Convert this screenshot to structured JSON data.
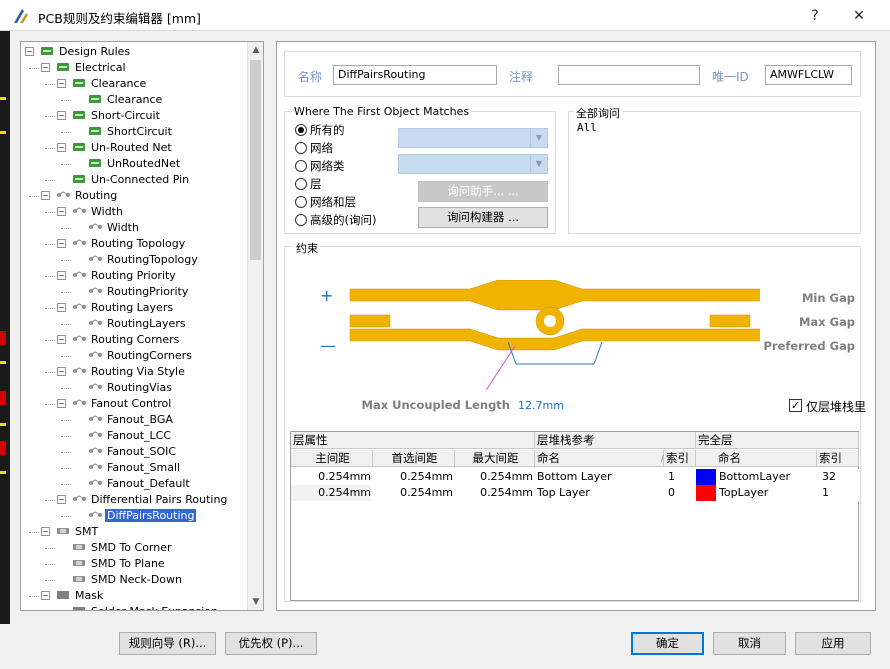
{
  "window": {
    "title": "PCB规则及约束编辑器 [mm]",
    "help_btn": "?",
    "close_btn": "✕"
  },
  "tree": {
    "items": [
      {
        "label": "Design Rules",
        "icon": "rules-root-icon"
      },
      {
        "label": "Electrical",
        "icon": "electrical-icon"
      },
      {
        "label": "Clearance",
        "icon": "clearance-icon"
      },
      {
        "label": "Clearance",
        "icon": "clearance-icon"
      },
      {
        "label": "Short-Circuit",
        "icon": "short-circuit-icon"
      },
      {
        "label": "ShortCircuit",
        "icon": "short-circuit-icon"
      },
      {
        "label": "Un-Routed Net",
        "icon": "unrouted-net-icon"
      },
      {
        "label": "UnRoutedNet",
        "icon": "unrouted-net-icon"
      },
      {
        "label": "Un-Connected Pin",
        "icon": "unconnected-pin-icon"
      },
      {
        "label": "Routing",
        "icon": "routing-icon"
      },
      {
        "label": "Width",
        "icon": "routing-icon"
      },
      {
        "label": "Width",
        "icon": "routing-icon"
      },
      {
        "label": "Routing Topology",
        "icon": "routing-icon"
      },
      {
        "label": "RoutingTopology",
        "icon": "routing-icon"
      },
      {
        "label": "Routing Priority",
        "icon": "routing-icon"
      },
      {
        "label": "RoutingPriority",
        "icon": "routing-icon"
      },
      {
        "label": "Routing Layers",
        "icon": "routing-icon"
      },
      {
        "label": "RoutingLayers",
        "icon": "routing-icon"
      },
      {
        "label": "Routing Corners",
        "icon": "routing-icon"
      },
      {
        "label": "RoutingCorners",
        "icon": "routing-icon"
      },
      {
        "label": "Routing Via Style",
        "icon": "routing-icon"
      },
      {
        "label": "RoutingVias",
        "icon": "routing-icon"
      },
      {
        "label": "Fanout Control",
        "icon": "routing-icon"
      },
      {
        "label": "Fanout_BGA",
        "icon": "routing-icon"
      },
      {
        "label": "Fanout_LCC",
        "icon": "routing-icon"
      },
      {
        "label": "Fanout_SOIC",
        "icon": "routing-icon"
      },
      {
        "label": "Fanout_Small",
        "icon": "routing-icon"
      },
      {
        "label": "Fanout_Default",
        "icon": "routing-icon"
      },
      {
        "label": "Differential Pairs Routing",
        "icon": "routing-icon"
      },
      {
        "label": "DiffPairsRouting",
        "icon": "routing-icon"
      },
      {
        "label": "SMT",
        "icon": "smt-icon"
      },
      {
        "label": "SMD To Corner",
        "icon": "smt-icon"
      },
      {
        "label": "SMD To Plane",
        "icon": "smt-icon"
      },
      {
        "label": "SMD Neck-Down",
        "icon": "smt-icon"
      },
      {
        "label": "Mask",
        "icon": "mask-icon"
      },
      {
        "label": "Solder Mask Expansion",
        "icon": "mask-icon"
      }
    ]
  },
  "rule": {
    "name_label": "名称",
    "name_value": "DiffPairsRouting",
    "comment_label": "注释",
    "comment_value": "",
    "uid_label": "唯一ID",
    "uid_value": "AMWFLCLW"
  },
  "match": {
    "group_title": "Where The First Object Matches",
    "options": [
      "所有的",
      "网络",
      "网络类",
      "层",
      "网络和层",
      "高级的(询问)"
    ],
    "selected": "所有的",
    "query_helper_btn": "询问助手... ...",
    "query_builder_btn": "询问构建器 ..."
  },
  "full_query": {
    "title": "全部询问",
    "text": "All"
  },
  "constraints": {
    "title": "约束",
    "plus": "+",
    "minus": "—",
    "min_gap_label": "Min Gap",
    "max_gap_label": "Max Gap",
    "preferred_gap_label": "Preferred Gap",
    "max_uncoupled_label": "Max Uncoupled Length",
    "max_uncoupled_value": "12.7mm",
    "layer_stack_only_label": "仅层堆栈里",
    "layer_stack_only_checked": true
  },
  "grid": {
    "group_layer_attr": "层属性",
    "group_stack_ref": "层堆栈参考",
    "group_full_layer": "完全层",
    "columns": [
      "主间距",
      "首选间距",
      "最大间距",
      "命名",
      "索引",
      "命名",
      "索引"
    ],
    "rows": [
      {
        "min": "0.254mm",
        "pref": "0.254mm",
        "max": "0.254mm",
        "stack_name": "Bottom Layer",
        "stack_index": "1",
        "layer_color": "#0000ff",
        "layer_name": "BottomLayer",
        "layer_index": "32"
      },
      {
        "min": "0.254mm",
        "pref": "0.254mm",
        "max": "0.254mm",
        "stack_name": "Top Layer",
        "stack_index": "0",
        "layer_color": "#ff0000",
        "layer_name": "TopLayer",
        "layer_index": "1"
      }
    ]
  },
  "footer": {
    "rule_wizard": "规则向导 (R)...",
    "priorities": "优先权 (P)...",
    "ok": "确定",
    "cancel": "取消",
    "apply": "应用"
  },
  "colors": {
    "trace": "#f0b400",
    "selection": "#3367d6",
    "label_blue": "#7b96c3"
  }
}
